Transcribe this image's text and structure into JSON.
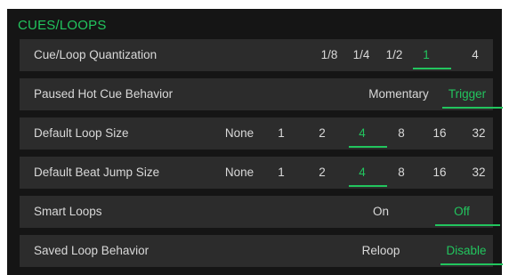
{
  "section_title": "CUES/LOOPS",
  "accent_color": "#22c55e",
  "rows": [
    {
      "label": "Cue/Loop Quantization",
      "options": [
        "1/8",
        "1/4",
        "1/2",
        "1",
        "4"
      ],
      "selected": "1"
    },
    {
      "label": "Paused Hot Cue Behavior",
      "options": [
        "Momentary",
        "Trigger"
      ],
      "selected": "Trigger"
    },
    {
      "label": "Default Loop Size",
      "options": [
        "None",
        "1",
        "2",
        "4",
        "8",
        "16",
        "32"
      ],
      "selected": "4"
    },
    {
      "label": "Default Beat Jump Size",
      "options": [
        "None",
        "1",
        "2",
        "4",
        "8",
        "16",
        "32"
      ],
      "selected": "4"
    },
    {
      "label": "Smart Loops",
      "options": [
        "On",
        "Off"
      ],
      "selected": "Off"
    },
    {
      "label": "Saved Loop Behavior",
      "options": [
        "Reloop",
        "Disable"
      ],
      "selected": "Disable"
    }
  ]
}
